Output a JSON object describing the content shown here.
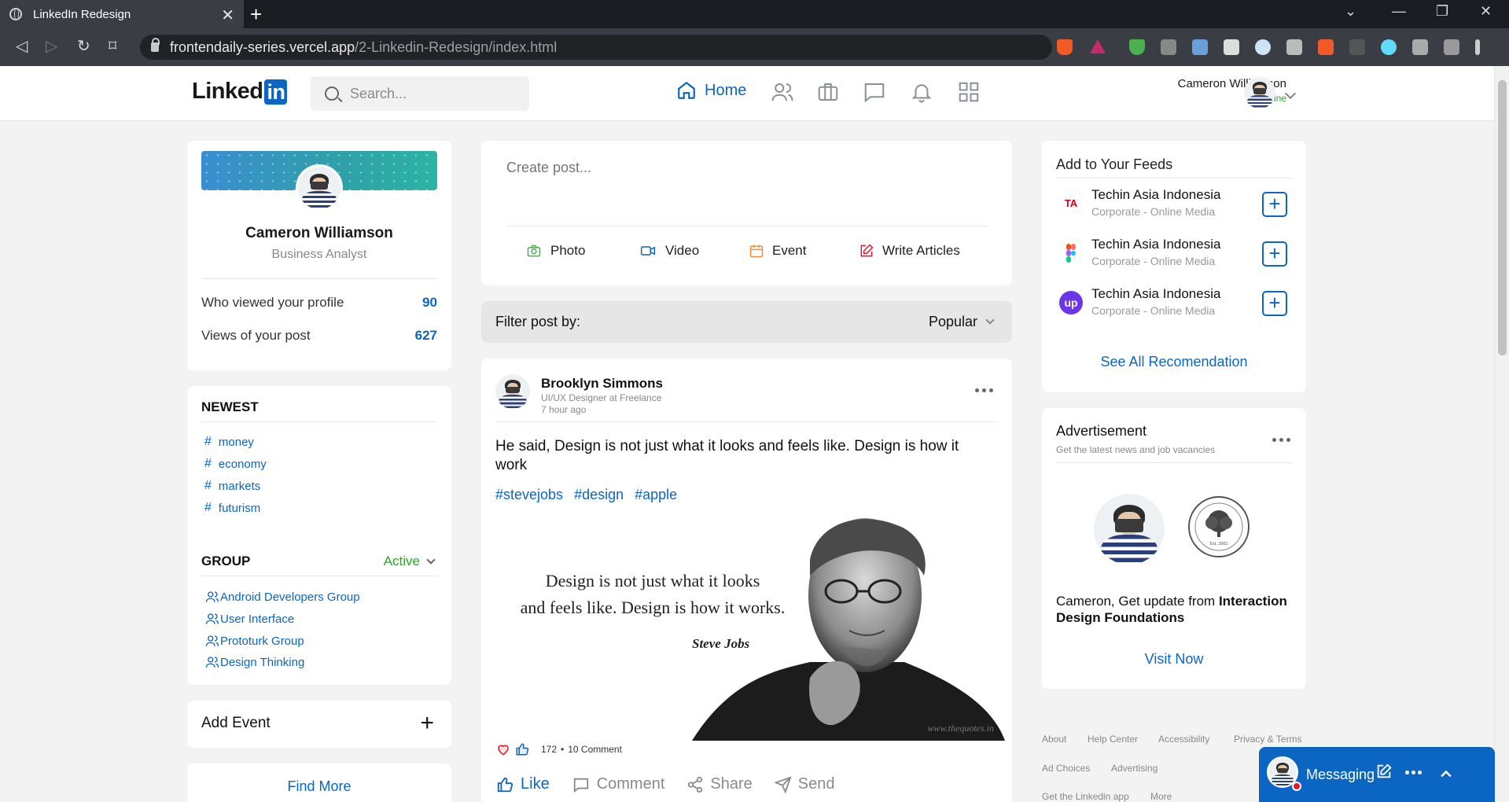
{
  "browser": {
    "tab_title": "LinkedIn Redesign",
    "url_host": "frontendaily-series.vercel.app",
    "url_path": "/2-Linkedin-Redesign/index.html"
  },
  "header": {
    "logo_text": "Linked",
    "logo_in": "in",
    "search_placeholder": "Search...",
    "home_label": "Home",
    "user_name": "Cameron Williamson",
    "user_status": "Online"
  },
  "profile": {
    "name": "Cameron Williamson",
    "title": "Business Analyst",
    "stats": [
      {
        "label": "Who viewed your profile",
        "value": "90"
      },
      {
        "label": "Views of your post",
        "value": "627"
      }
    ]
  },
  "newest": {
    "title": "NEWEST",
    "tags": [
      "money",
      "economy",
      "markets",
      "futurism"
    ]
  },
  "group": {
    "title": "GROUP",
    "filter": "Active",
    "items": [
      "Android Developers Group",
      "User Interface",
      "Prototurk Group",
      "Design Thinking"
    ]
  },
  "add_event": "Add Event",
  "find_more": "Find More",
  "create_post": {
    "placeholder": "Create post...",
    "actions": [
      "Photo",
      "Video",
      "Event",
      "Write Articles"
    ]
  },
  "filter": {
    "label": "Filter post by:",
    "value": "Popular"
  },
  "post": {
    "author": "Brooklyn Simmons",
    "role": "UI/UX Designer at Freelance",
    "time": "7 hour ago",
    "text": "He said, Design is not just what it looks and feels like. Design is how it work",
    "hashtags": [
      "#stevejobs",
      "#design",
      "#apple"
    ],
    "quote_line1": "Design is not just what it looks",
    "quote_line2": "and feels like. Design is how it works.",
    "quote_author": "Steve Jobs",
    "quote_site": "www.thequotes.in",
    "reactions_count": "172",
    "comments_count": "10 Comment",
    "actions": [
      "Like",
      "Comment",
      "Share",
      "Send"
    ]
  },
  "feeds": {
    "title": "Add to Your Feeds",
    "items": [
      {
        "name": "Techin Asia Indonesia",
        "sub": "Corporate - Online Media"
      },
      {
        "name": "Techin Asia Indonesia",
        "sub": "Corporate - Online Media"
      },
      {
        "name": "Techin Asia Indonesia",
        "sub": "Corporate - Online Media"
      }
    ],
    "see_all": "See All Recomendation"
  },
  "ad": {
    "title": "Advertisement",
    "subtitle": "Get the latest news and job vacancies",
    "text_prefix": "Cameron, Get update from ",
    "text_bold": "Interaction Design Foundations",
    "cta": "Visit Now",
    "logo_text": "Est. 2002"
  },
  "footer": {
    "links": [
      "About",
      "Help Center",
      "Accessibility",
      "Privacy & Terms",
      "Ad Choices",
      "Advertising",
      "Get the Linkedin app",
      "More"
    ]
  },
  "messaging": {
    "label": "Messaging"
  },
  "colors": {
    "brand": "#0a66c2",
    "online": "#2aa52a",
    "heart": "#e0192b"
  }
}
